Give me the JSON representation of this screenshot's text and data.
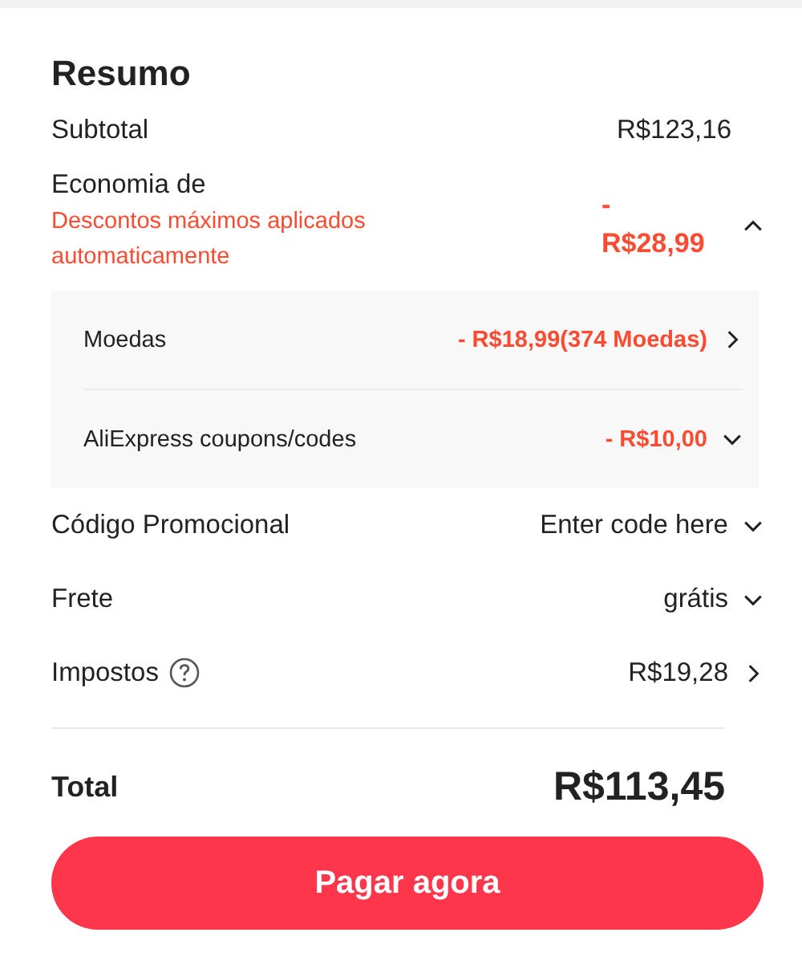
{
  "title": "Resumo",
  "subtotal": {
    "label": "Subtotal",
    "value": "R$123,16"
  },
  "savings": {
    "label": "Economia de",
    "note": "Descontos máximos aplicados automaticamente",
    "value": "- R$28,99",
    "expanded": true,
    "items": [
      {
        "label": "Moedas",
        "value": "- R$18,99(374 Moedas)",
        "kind": "link"
      },
      {
        "label": "AliExpress coupons/codes",
        "value": "- R$10,00",
        "kind": "dropdown"
      }
    ]
  },
  "rows": [
    {
      "label": "Código Promocional",
      "value": "Enter code here",
      "kind": "dropdown",
      "help": false
    },
    {
      "label": "Frete",
      "value": "grátis",
      "kind": "dropdown",
      "help": false
    },
    {
      "label": "Impostos",
      "value": "R$19,28",
      "kind": "link",
      "help": true
    }
  ],
  "total": {
    "label": "Total",
    "value": "R$113,45"
  },
  "button": "Pagar agora"
}
